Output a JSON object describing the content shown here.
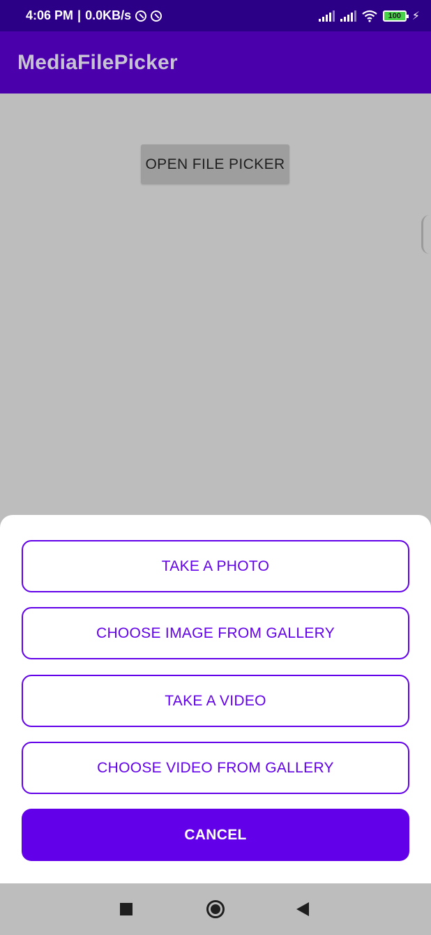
{
  "status_bar": {
    "time": "4:06 PM",
    "separator": "|",
    "network_speed": "0.0KB/s",
    "battery": "100"
  },
  "app_bar": {
    "title": "MediaFilePicker"
  },
  "main": {
    "open_picker_label": "OPEN FILE PICKER"
  },
  "bottom_sheet": {
    "options": [
      {
        "label": "TAKE A PHOTO"
      },
      {
        "label": "CHOOSE IMAGE FROM GALLERY"
      },
      {
        "label": "TAKE A VIDEO"
      },
      {
        "label": "CHOOSE VIDEO FROM GALLERY"
      }
    ],
    "cancel_label": "CANCEL"
  },
  "colors": {
    "status_bar_bg": "#2b0087",
    "app_bar_bg": "#4a00ab",
    "accent": "#6200ea",
    "scrim": "#bdbdbd"
  },
  "icons": {
    "status": [
      "do-not-disturb-icon",
      "data-saver-icon",
      "signal-icon",
      "signal-icon",
      "wifi-icon",
      "battery-icon",
      "charging-icon"
    ],
    "nav": [
      "recents-icon",
      "home-icon",
      "back-icon"
    ]
  }
}
